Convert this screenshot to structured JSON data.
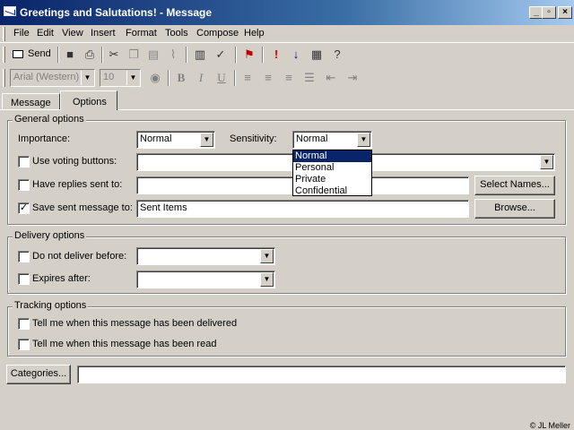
{
  "window": {
    "title": "Greetings and Salutations! - Message",
    "controls": [
      "_",
      "▫",
      "×"
    ]
  },
  "menu": [
    "File",
    "Edit",
    "View",
    "Insert",
    "Format",
    "Tools",
    "Compose",
    "Help"
  ],
  "toolbar": {
    "send_label": "Send",
    "icons": [
      "send-icon",
      "save-icon",
      "print-icon",
      "cut-icon",
      "copy-icon",
      "paste-icon",
      "attach-icon",
      "address-book-icon",
      "check-names-icon",
      "flag-icon",
      "high-importance-icon",
      "low-importance-icon",
      "options-icon",
      "help-icon"
    ]
  },
  "format_toolbar": {
    "font": "Arial (Western)",
    "size": "10",
    "bold": "B",
    "italic": "I",
    "underline": "U"
  },
  "tabs": [
    {
      "label": "Message",
      "active": false
    },
    {
      "label": "Options",
      "active": true
    }
  ],
  "general": {
    "title": "General options",
    "importance_label": "Importance:",
    "importance_value": "Normal",
    "sensitivity_label": "Sensitivity:",
    "sensitivity_value": "Normal",
    "sensitivity_options": [
      "Normal",
      "Personal",
      "Private",
      "Confidential"
    ],
    "voting_label": "Use voting buttons:",
    "voting_checked": false,
    "replies_label": "Have replies sent to:",
    "replies_checked": false,
    "select_names_label": "Select Names...",
    "save_sent_label": "Save sent message to:",
    "save_sent_checked": true,
    "save_sent_value": "Sent Items",
    "browse_label": "Browse..."
  },
  "delivery": {
    "title": "Delivery options",
    "not_before_label": "Do not deliver before:",
    "expires_label": "Expires after:"
  },
  "tracking": {
    "title": "Tracking options",
    "delivered_label": "Tell me when this message has been delivered",
    "read_label": "Tell me when this message has been read"
  },
  "categories": {
    "button_label": "Categories...",
    "value": ""
  },
  "credit": "© JL Meller",
  "colors": {
    "titlebar_start": "#0a246a",
    "titlebar_end": "#a6caf0",
    "face": "#d4d0c8",
    "selection": "#0a246a"
  }
}
